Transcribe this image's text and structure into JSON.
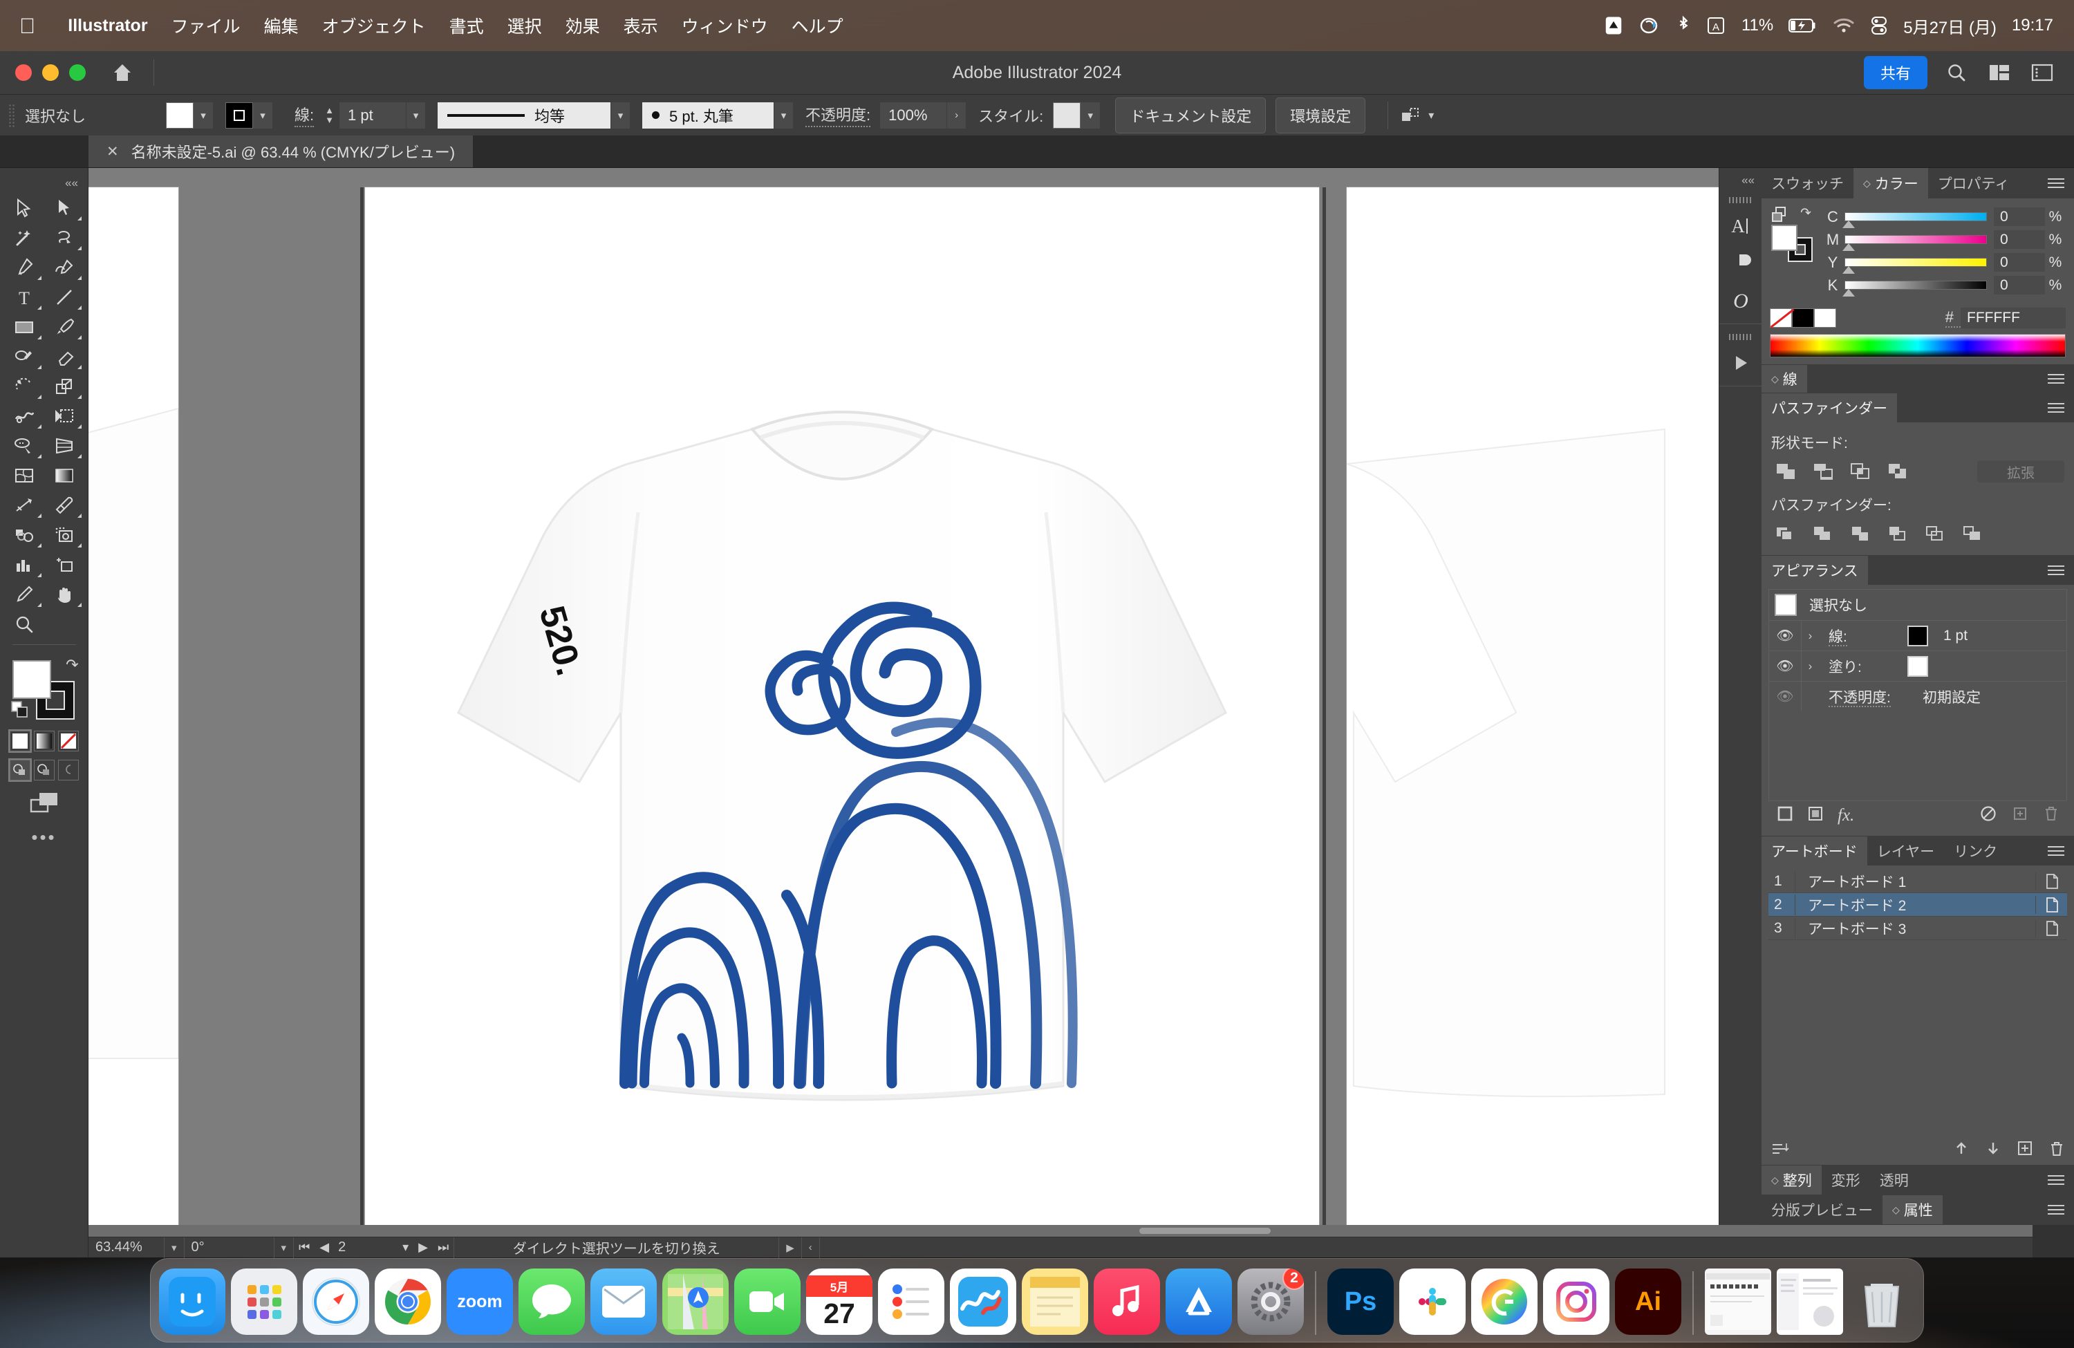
{
  "menubar": {
    "apple_icon": "apple-icon",
    "items": [
      {
        "label": "Illustrator",
        "bold": true
      },
      {
        "label": "ファイル",
        "bold": false
      },
      {
        "label": "編集",
        "bold": false
      },
      {
        "label": "オブジェクト",
        "bold": false
      },
      {
        "label": "書式",
        "bold": false
      },
      {
        "label": "選択",
        "bold": false
      },
      {
        "label": "効果",
        "bold": false
      },
      {
        "label": "表示",
        "bold": false
      },
      {
        "label": "ウィンドウ",
        "bold": false
      },
      {
        "label": "ヘルプ",
        "bold": false
      }
    ],
    "status": {
      "battery_percent": "11%",
      "date": "5月27日 (月)",
      "time": "19:17",
      "icons": [
        "dropbox-icon",
        "creative-cloud-icon",
        "bluetooth-icon",
        "input-source-icon",
        "battery-icon",
        "wifi-icon",
        "control-center-icon"
      ]
    }
  },
  "titlebar": {
    "title": "Adobe Illustrator 2024",
    "share_label": "共有",
    "icons": [
      "home-icon",
      "search-icon",
      "workspace-icon",
      "panel-icon"
    ]
  },
  "control_bar": {
    "selection_status": "選択なし",
    "fill_color": "#FFFFFF",
    "stroke_color": "#000000",
    "stroke_label": "線:",
    "stroke_weight": "1 pt",
    "stroke_profile": "均等",
    "brush": "5 pt. 丸筆",
    "opacity_label": "不透明度:",
    "opacity_value": "100%",
    "style_label": "スタイル:",
    "document_setup_label": "ドキュメント設定",
    "preferences_label": "環境設定"
  },
  "document_tab": {
    "close_icon": "close-icon",
    "label": "名称未設定-5.ai @ 63.44 % (CMYK/プレビュー)"
  },
  "toolbar": {
    "tools": [
      {
        "name": "selection-tool",
        "active": false
      },
      {
        "name": "direct-selection-tool",
        "active": false
      },
      {
        "name": "magic-wand-tool",
        "active": false
      },
      {
        "name": "lasso-tool",
        "active": false
      },
      {
        "name": "pen-tool",
        "active": false
      },
      {
        "name": "curvature-tool",
        "active": false
      },
      {
        "name": "type-tool",
        "active": false
      },
      {
        "name": "line-segment-tool",
        "active": false
      },
      {
        "name": "rectangle-tool",
        "active": false
      },
      {
        "name": "paintbrush-tool",
        "active": false
      },
      {
        "name": "shaper-tool",
        "active": false
      },
      {
        "name": "eraser-tool",
        "active": false
      },
      {
        "name": "rotate-tool",
        "active": false
      },
      {
        "name": "scale-tool",
        "active": false
      },
      {
        "name": "width-tool",
        "active": false
      },
      {
        "name": "free-transform-tool",
        "active": false
      },
      {
        "name": "shape-builder-tool",
        "active": false
      },
      {
        "name": "perspective-grid-tool",
        "active": false
      },
      {
        "name": "mesh-tool",
        "active": false
      },
      {
        "name": "gradient-tool",
        "active": false
      },
      {
        "name": "blend-tool",
        "active": false
      },
      {
        "name": "eyedropper-tool",
        "active": false
      },
      {
        "name": "symbol-sprayer-tool",
        "active": false
      },
      {
        "name": "image-trace-tool",
        "active": false
      },
      {
        "name": "column-graph-tool",
        "active": false
      },
      {
        "name": "artboard-tool",
        "active": false
      },
      {
        "name": "slice-tool",
        "active": false
      },
      {
        "name": "hand-tool",
        "active": false
      },
      {
        "name": "zoom-tool",
        "active": false
      }
    ],
    "fill_color": "#FFFFFF",
    "stroke_color": "#000000"
  },
  "canvas": {
    "artboards": [
      {
        "id": "ab1",
        "tee_badge": ""
      },
      {
        "id": "ab2",
        "tee_badge": "520."
      },
      {
        "id": "ab3",
        "tee_badge": ""
      }
    ],
    "artwork_color": "#1f4f9c",
    "tee_color": "#ffffff"
  },
  "statusbar": {
    "zoom_level": "63.44%",
    "rotation": "0°",
    "artboard_number": "2",
    "tool_hint": "ダイレクト選択ツールを切り換え"
  },
  "rail": {
    "collapse_icon": "chevrons-left-icon",
    "icons": [
      "character-panel-icon",
      "paragraph-panel-icon",
      "opentype-panel-icon",
      "libraries-panel-icon"
    ]
  },
  "panels": {
    "color_panel": {
      "tabs": [
        {
          "label": "スウォッチ",
          "active": false
        },
        {
          "label": "カラー",
          "active": true
        },
        {
          "label": "プロパティ",
          "active": false
        }
      ],
      "sliders": [
        {
          "label": "C",
          "value": "0",
          "unit": "%"
        },
        {
          "label": "M",
          "value": "0",
          "unit": "%"
        },
        {
          "label": "Y",
          "value": "0",
          "unit": "%"
        },
        {
          "label": "K",
          "value": "0",
          "unit": "%"
        }
      ],
      "hex_label": "#",
      "hex_value": "FFFFFF"
    },
    "stroke_panel": {
      "tabs": [
        {
          "label": "線",
          "active": true
        }
      ]
    },
    "pathfinder_panel": {
      "tabs": [
        {
          "label": "パスファインダー",
          "active": true
        }
      ],
      "shape_modes_label": "形状モード:",
      "expand_label": "拡張",
      "pathfinders_label": "パスファインダー:",
      "shape_mode_buttons": [
        "unite-icon",
        "minus-front-icon",
        "intersect-icon",
        "exclude-icon"
      ],
      "pathfinder_buttons": [
        "divide-icon",
        "trim-icon",
        "merge-icon",
        "crop-icon",
        "outline-icon",
        "minus-back-icon"
      ]
    },
    "appearance_panel": {
      "tabs": [
        {
          "label": "アピアランス",
          "active": true
        }
      ],
      "target_label": "選択なし",
      "rows": [
        {
          "name": "線:",
          "value": "1 pt",
          "swatch": "#000000",
          "eye": true
        },
        {
          "name": "塗り:",
          "value": "",
          "swatch": "#ffffff",
          "eye": true
        },
        {
          "name": "不透明度:",
          "value": "初期設定",
          "swatch": "",
          "eye": false
        }
      ],
      "tool_icons": [
        "add-new-stroke-icon",
        "add-new-fill-icon",
        "add-effect-icon",
        "clear-appearance-icon",
        "duplicate-item-icon",
        "delete-item-icon"
      ]
    },
    "artboards_panel": {
      "tabs": [
        {
          "label": "アートボード",
          "active": true
        },
        {
          "label": "レイヤー",
          "active": false
        },
        {
          "label": "リンク",
          "active": false
        }
      ],
      "rows": [
        {
          "num": "1",
          "name": "アートボード 1",
          "selected": false
        },
        {
          "num": "2",
          "name": "アートボード 2",
          "selected": true
        },
        {
          "num": "3",
          "name": "アートボード 3",
          "selected": false
        }
      ],
      "tool_icons": [
        "reorder-icon",
        "move-up-icon",
        "move-down-icon",
        "new-artboard-icon",
        "delete-artboard-icon"
      ]
    },
    "align_panel": {
      "tabs": [
        {
          "label": "整列",
          "active": true
        },
        {
          "label": "変形",
          "active": false
        },
        {
          "label": "透明",
          "active": false
        }
      ]
    },
    "separation_panel": {
      "tabs": [
        {
          "label": "分版プレビュー",
          "active": false
        },
        {
          "label": "属性",
          "active": true
        }
      ]
    }
  },
  "dock": {
    "apps": [
      {
        "name": "finder",
        "label": "",
        "color": "#1d9bf5",
        "running": true
      },
      {
        "name": "launchpad",
        "label": "",
        "color": "#e9e9ee",
        "running": false
      },
      {
        "name": "safari",
        "label": "",
        "color": "#f2f6fb",
        "running": false
      },
      {
        "name": "chrome",
        "label": "",
        "color": "#ffffff",
        "running": true
      },
      {
        "name": "zoom",
        "label": "zoom",
        "color": "#2d8cff",
        "running": false
      },
      {
        "name": "messages",
        "label": "",
        "color": "#4ad863",
        "running": true
      },
      {
        "name": "mail",
        "label": "",
        "color": "#3fa9f5",
        "running": true
      },
      {
        "name": "maps",
        "label": "",
        "color": "#8fdc6d",
        "running": false
      },
      {
        "name": "facetime",
        "label": "",
        "color": "#4ad863",
        "running": false
      },
      {
        "name": "calendar",
        "label": "27",
        "color": "#ffffff",
        "running": false
      },
      {
        "name": "reminders",
        "label": "",
        "color": "#ffffff",
        "running": true
      },
      {
        "name": "stocks",
        "label": "",
        "color": "#ffffff",
        "running": true
      },
      {
        "name": "notes",
        "label": "",
        "color": "#fde38a",
        "running": false
      },
      {
        "name": "music",
        "label": "",
        "color": "#fb2d55",
        "running": true
      },
      {
        "name": "app-store",
        "label": "",
        "color": "#1d9bf5",
        "running": false
      },
      {
        "name": "system-settings",
        "label": "",
        "color": "#8e8e93",
        "running": true,
        "badge": "2"
      },
      {
        "name": "photoshop",
        "label": "Ps",
        "color": "#001e36",
        "running": true
      },
      {
        "name": "slack",
        "label": "",
        "color": "#ffffff",
        "running": true
      },
      {
        "name": "creative-cloud",
        "label": "",
        "color": "#ffffff",
        "running": true
      },
      {
        "name": "instagram",
        "label": "",
        "color": "#ffffff",
        "running": true
      },
      {
        "name": "illustrator",
        "label": "Ai",
        "color": "#330000",
        "running": true
      }
    ],
    "minimized": [
      "window-thumb-1",
      "window-thumb-2"
    ],
    "trash": "trash-icon"
  }
}
